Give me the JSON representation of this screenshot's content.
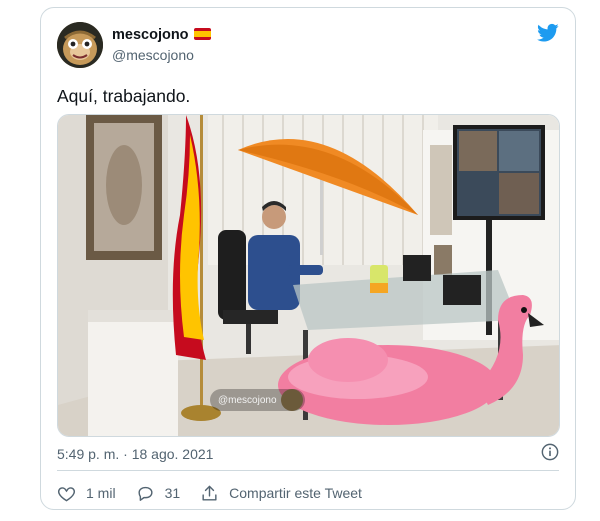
{
  "tweet": {
    "display_name": "mescojono",
    "handle": "@mescojono",
    "text": "Aquí, trabajando.",
    "timestamp": "5:49 p. m. · 18 ago. 2021",
    "media": {
      "watermark": "@mescojono"
    }
  },
  "actions": {
    "likes": "1 mil",
    "replies": "31",
    "share_label": "Compartir este Tweet"
  },
  "icons": {
    "brand": "twitter-bird-icon",
    "flag": "spain-flag-icon",
    "info": "info-icon",
    "like": "heart-icon",
    "reply": "reply-icon",
    "share": "share-icon"
  },
  "colors": {
    "twitter_blue": "#1d9bf0",
    "secondary_text": "#536471",
    "border": "#cfd9de"
  }
}
